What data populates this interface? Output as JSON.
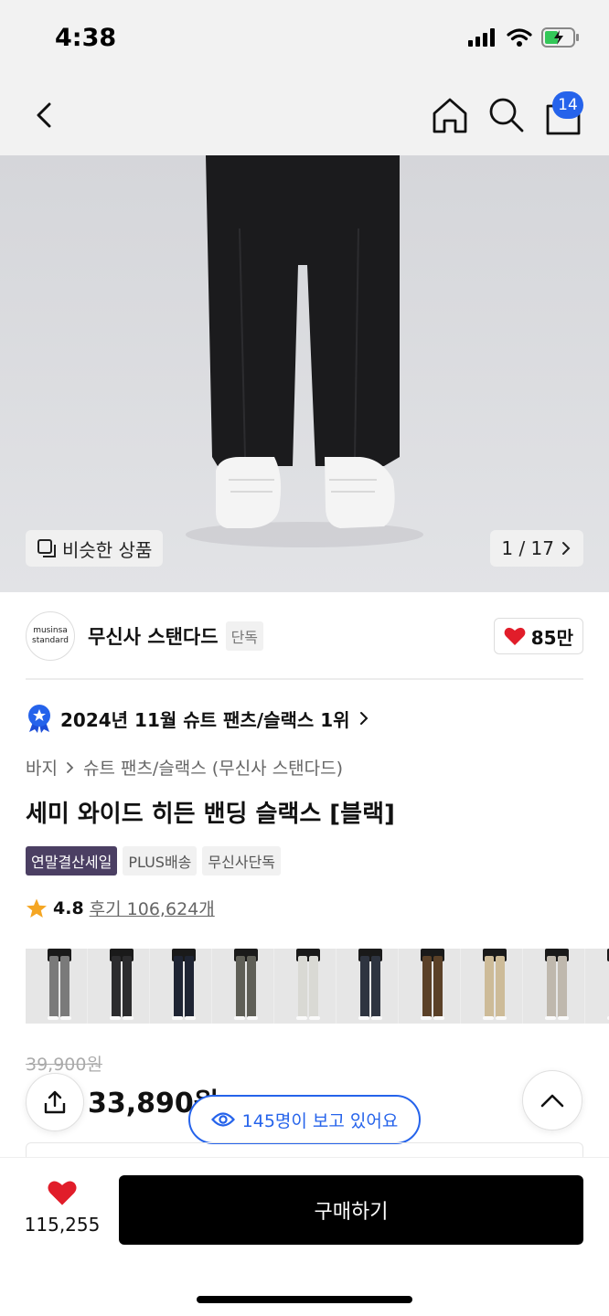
{
  "status": {
    "time": "4:38"
  },
  "nav": {
    "cart_count": "14"
  },
  "hero": {
    "similar_label": "비슷한 상품",
    "pager": "1 / 17"
  },
  "brand": {
    "logo_line1": "musinsa",
    "logo_line2": "standard",
    "name": "무신사 스탠다드",
    "tag": "단독",
    "likes": "85만"
  },
  "rank": {
    "text": "2024년 11월 슈트 팬츠/슬랙스 1위"
  },
  "breadcrumb": {
    "cat1": "바지",
    "cat2": "슈트 팬츠/슬랙스 (무신사 스탠다드)"
  },
  "product": {
    "title": "세미 와이드 히든 밴딩 슬랙스 [블랙]",
    "tags": [
      "연말결산세일",
      "PLUS배송",
      "무신사단독"
    ],
    "rating": "4.8",
    "reviews": "후기 106,624개",
    "original_price": "39,900원",
    "price": "33,890원"
  },
  "color_variants": [
    {
      "color": "#7a7a7a"
    },
    {
      "color": "#2c2c2e"
    },
    {
      "color": "#1e2433"
    },
    {
      "color": "#5f5f57"
    },
    {
      "color": "#d9d9d4"
    },
    {
      "color": "#2e3440"
    },
    {
      "color": "#5b4128"
    },
    {
      "color": "#cdbb98"
    },
    {
      "color": "#bfb8ad"
    },
    {
      "color": "#2a2a2a"
    }
  ],
  "viewers": {
    "text": "145명이 보고 있어요"
  },
  "bottom": {
    "wish_count": "115,255",
    "buy_label": "구매하기"
  },
  "colors": {
    "accent": "#2563eb",
    "heart": "#e11d2a",
    "sale_tag": "#4b3f63",
    "star": "#f5a623"
  }
}
